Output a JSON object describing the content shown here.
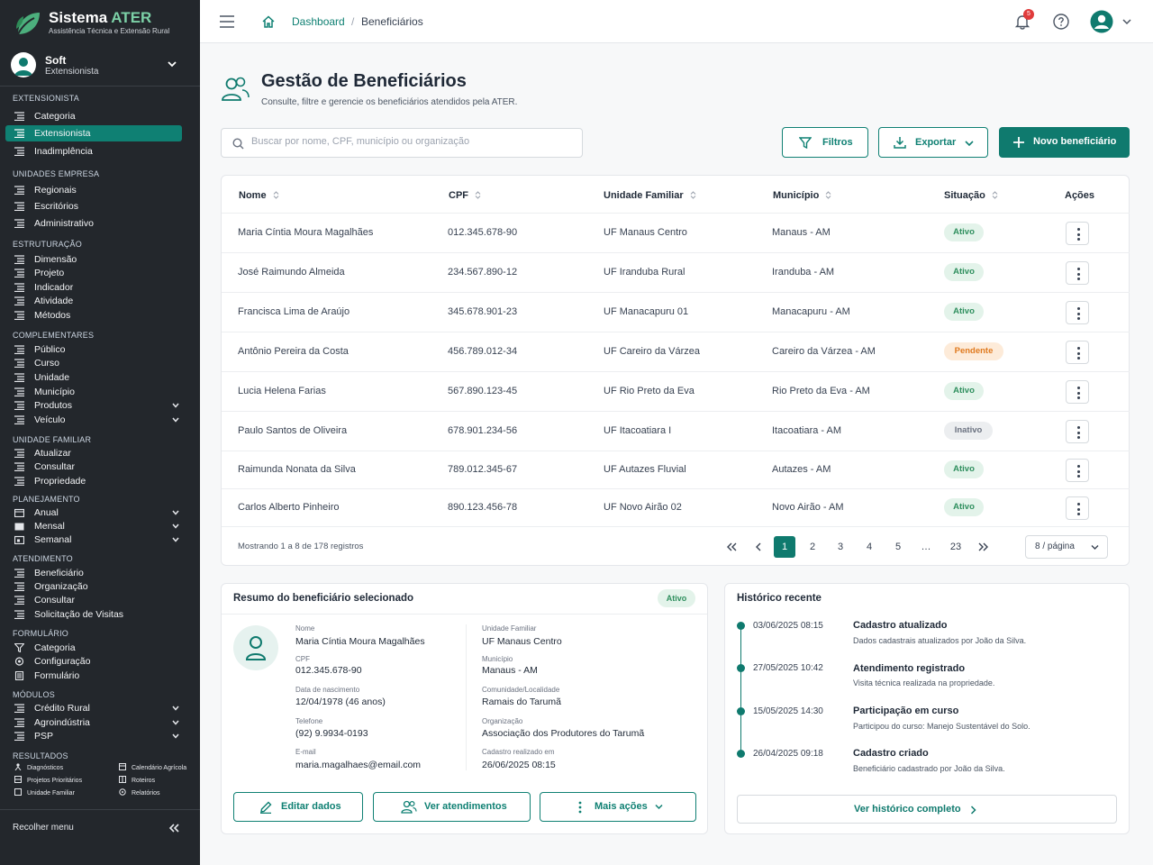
{
  "app": {
    "name_a": "Sistema",
    "name_b": "ATER",
    "tagline": "Assistência Técnica e Extensão Rural"
  },
  "user": {
    "name": "Soft",
    "role": "Extensionista"
  },
  "sidebar": {
    "extensionista": {
      "title": "EXTENSIONISTA",
      "items": [
        "Categoria",
        "Extensionista",
        "Inadimplência"
      ]
    },
    "unidades": {
      "title": "UNIDADES EMPRESA",
      "items": [
        "Regionais",
        "Escritórios",
        "Administrativo"
      ]
    },
    "estrutura": {
      "title": "ESTRUTURAÇÃO",
      "items": [
        "Dimensão",
        "Projeto",
        "Indicador",
        "Atividade",
        "Métodos"
      ]
    },
    "complementares": {
      "title": "COMPLEMENTARES",
      "items": [
        "Público",
        "Curso",
        "Unidade",
        "Município",
        "Produtos",
        "Veículo"
      ]
    },
    "familiar": {
      "title": "UNIDADE FAMILIAR",
      "items": [
        "Atualizar",
        "Consultar",
        "Propriedade"
      ]
    },
    "planejamento": {
      "title": "PLANEJAMENTO",
      "items": [
        "Anual",
        "Mensal",
        "Semanal"
      ]
    },
    "atendimento": {
      "title": "ATENDIMENTO",
      "items": [
        "Beneficiário",
        "Organização",
        "Consultar",
        "Solicitação de Visitas"
      ]
    },
    "formulario": {
      "title": "FORMULÁRIO",
      "items": [
        "Categoria",
        "Configuração",
        "Formulário"
      ]
    },
    "modulos": {
      "title": "MÓDULOS",
      "items": [
        "Crédito Rural",
        "Agroindústria",
        "PSP"
      ]
    },
    "resultados": {
      "title": "RESULTADOS",
      "items": [
        "Diagnósticos",
        "Projetos Prioritários",
        "Unidade Familiar",
        "Calendário Agrícola",
        "Roteiros",
        "Relatórios"
      ]
    },
    "collapse": "Recolher menu"
  },
  "topbar": {
    "crumb_home": "Dashboard",
    "crumb_sep": "/",
    "crumb_current": "Beneficiários",
    "notif_count": "5"
  },
  "page": {
    "title": "Gestão de Beneficiários",
    "subtitle": "Consulte, filtre e gerencie os beneficiários atendidos pela ATER."
  },
  "search": {
    "placeholder": "Buscar por nome, CPF, município ou organização"
  },
  "actions": {
    "filters": "Filtros",
    "export": "Exportar",
    "new": "Novo beneficiário"
  },
  "table": {
    "headers": {
      "nome": "Nome",
      "cpf": "CPF",
      "uf": "Unidade Familiar",
      "mun": "Município",
      "sit": "Situação",
      "acoes": "Ações"
    },
    "rows": [
      {
        "nome": "Maria Cíntia Moura Magalhães",
        "cpf": "012.345.678-90",
        "uf": "UF Manaus Centro",
        "mun": "Manaus - AM",
        "sit": "Ativo"
      },
      {
        "nome": "José Raimundo Almeida",
        "cpf": "234.567.890-12",
        "uf": "UF Iranduba Rural",
        "mun": "Iranduba - AM",
        "sit": "Ativo"
      },
      {
        "nome": "Francisca Lima de Araújo",
        "cpf": "345.678.901-23",
        "uf": "UF Manacapuru 01",
        "mun": "Manacapuru - AM",
        "sit": "Ativo"
      },
      {
        "nome": "Antônio Pereira da Costa",
        "cpf": "456.789.012-34",
        "uf": "UF Careiro da Várzea",
        "mun": "Careiro da Várzea - AM",
        "sit": "Pendente"
      },
      {
        "nome": "Lucia Helena Farias",
        "cpf": "567.890.123-45",
        "uf": "UF Rio Preto da Eva",
        "mun": "Rio Preto da Eva - AM",
        "sit": "Ativo"
      },
      {
        "nome": "Paulo Santos de Oliveira",
        "cpf": "678.901.234-56",
        "uf": "UF Itacoatiara I",
        "mun": "Itacoatiara - AM",
        "sit": "Inativo"
      },
      {
        "nome": "Raimunda Nonata da Silva",
        "cpf": "789.012.345-67",
        "uf": "UF Autazes Fluvial",
        "mun": "Autazes - AM",
        "sit": "Ativo"
      },
      {
        "nome": "Carlos Alberto Pinheiro",
        "cpf": "890.123.456-78",
        "uf": "UF Novo Airão 02",
        "mun": "Novo Airão - AM",
        "sit": "Ativo"
      }
    ],
    "showing": "Mostrando 1 a 8 de 178 registros",
    "pages": [
      "1",
      "2",
      "3",
      "4",
      "5",
      "…",
      "23"
    ],
    "current_page": "1",
    "per_page": "8 / página"
  },
  "summary": {
    "title": "Resumo do beneficiário selecionado",
    "status": "Ativo",
    "fields": {
      "nome_l": "Nome",
      "nome": "Maria Cíntia Moura Magalhães",
      "cpf_l": "CPF",
      "cpf": "012.345.678-90",
      "nasc_l": "Data de nascimento",
      "nasc": "12/04/1978 (46 anos)",
      "tel_l": "Telefone",
      "tel": "(92) 9.9934-0193",
      "email_l": "E-mail",
      "email": "maria.magalhaes@email.com",
      "uf_l": "Unidade Familiar",
      "uf": "UF Manaus Centro",
      "mun_l": "Município",
      "mun": "Manaus - AM",
      "com_l": "Comunidade/Localidade",
      "com": "Ramais do Tarumã",
      "org_l": "Organização",
      "org": "Associação dos Produtores do Tarumã",
      "cad_l": "Cadastro realizado em",
      "cad": "26/06/2025 08:15"
    },
    "btn_edit": "Editar dados",
    "btn_att": "Ver atendimentos",
    "btn_more": "Mais ações"
  },
  "history": {
    "title": "Histórico recente",
    "items": [
      {
        "date": "03/06/2025 08:15",
        "title": "Cadastro atualizado",
        "desc": "Dados cadastrais atualizados por João da Silva."
      },
      {
        "date": "27/05/2025 10:42",
        "title": "Atendimento registrado",
        "desc": "Visita técnica realizada na propriedade."
      },
      {
        "date": "15/05/2025 14:30",
        "title": "Participação em curso",
        "desc": "Participou do curso: Manejo Sustentável do Solo."
      },
      {
        "date": "26/04/2025 09:18",
        "title": "Cadastro criado",
        "desc": "Beneficiário cadastrado por João da Silva."
      }
    ],
    "link": "Ver histórico completo"
  },
  "colors": {
    "accent": "#0f7a6e",
    "sidebar_bg": "#23272c",
    "active": "#0f8073",
    "ativo": "#2f8f5e",
    "pendente": "#e07a1f",
    "alert": "#e03b3b"
  }
}
